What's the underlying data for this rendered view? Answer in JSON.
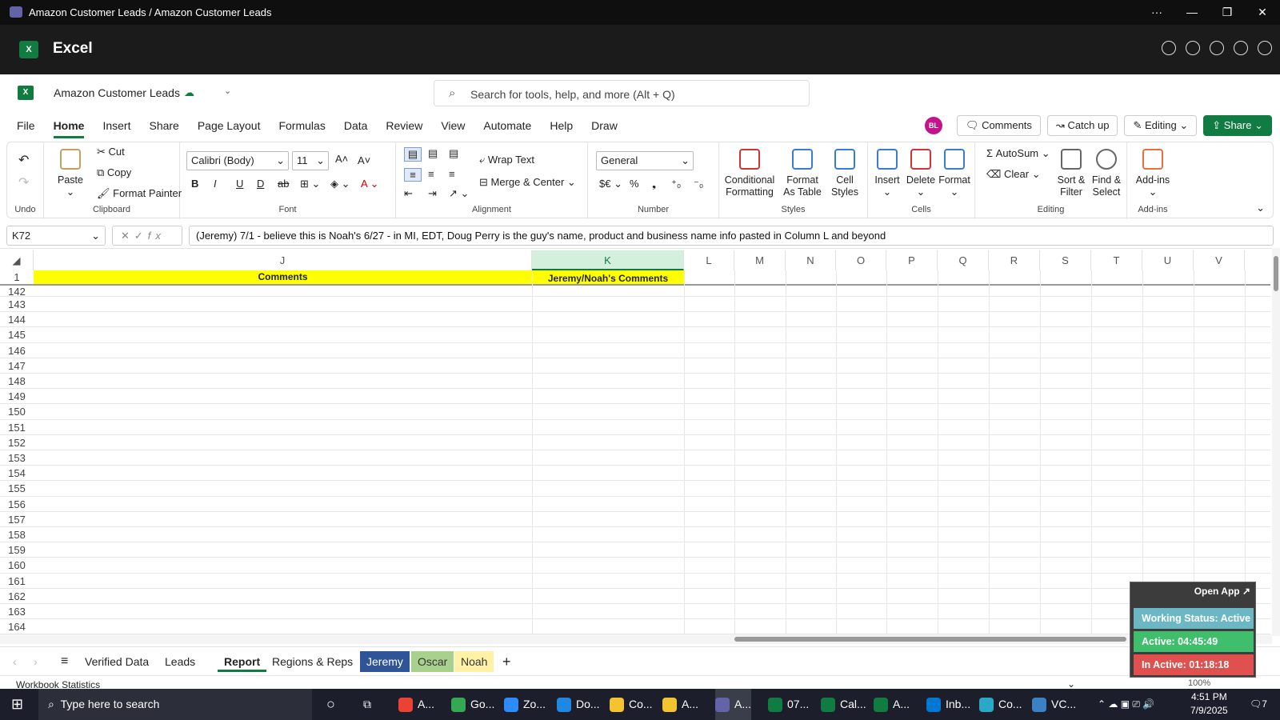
{
  "window": {
    "title": "Amazon Customer Leads / Amazon Customer Leads",
    "more": "···",
    "minimize": "—",
    "restore": "❐",
    "close": "✕"
  },
  "app": {
    "name": "Excel",
    "logo": "X"
  },
  "document": {
    "name": "Amazon Customer Leads",
    "logo": "X"
  },
  "search": {
    "placeholder": "Search for tools, help, and more (Alt + Q)"
  },
  "menu_tabs": [
    "File",
    "Home",
    "Insert",
    "Share",
    "Page Layout",
    "Formulas",
    "Data",
    "Review",
    "View",
    "Automate",
    "Help",
    "Draw"
  ],
  "active_tab": "Home",
  "header_buttons": {
    "avatar": "BL",
    "comments": "Comments",
    "catchup": "Catch up",
    "editing": "Editing",
    "share": "Share"
  },
  "ribbon": {
    "undo_label": "Undo",
    "clipboard": {
      "paste": "Paste",
      "cut": "Cut",
      "copy": "Copy",
      "format_painter": "Format Painter",
      "label": "Clipboard"
    },
    "font": {
      "family": "Calibri (Body)",
      "size": "11",
      "label": "Font"
    },
    "alignment": {
      "wrap": "Wrap Text",
      "merge": "Merge & Center",
      "label": "Alignment"
    },
    "number": {
      "format": "General",
      "label": "Number"
    },
    "styles": {
      "conditional": "Conditional Formatting",
      "format_table": "Format As Table",
      "cell_styles": "Cell Styles",
      "label": "Styles"
    },
    "cells": {
      "insert": "Insert",
      "delete": "Delete",
      "format": "Format",
      "label": "Cells"
    },
    "editing": {
      "autosum": "AutoSum",
      "clear": "Clear",
      "sort": "Sort & Filter",
      "find": "Find & Select",
      "label": "Editing"
    },
    "addins": {
      "addins": "Add-ins",
      "label": "Add-ins"
    }
  },
  "formula_bar": {
    "name_box": "K72",
    "fx": "fx",
    "formula": "(Jeremy) 7/1 -  believe this is Noah's 6/27 - in MI, EDT, Doug Perry is the guy's name, product and business name info pasted in Column L and beyond"
  },
  "grid": {
    "columns": [
      "J",
      "K",
      "L",
      "M",
      "N",
      "O",
      "P",
      "Q",
      "R",
      "S",
      "T",
      "U",
      "V"
    ],
    "selected_column": "K",
    "frozen_row": {
      "number": "1",
      "J": "Comments",
      "K": "Jeremy/Noah's Comments"
    },
    "rows": [
      "142",
      "143",
      "144",
      "145",
      "146",
      "147",
      "148",
      "149",
      "150",
      "151",
      "152",
      "153",
      "154",
      "155",
      "156",
      "157",
      "158",
      "159",
      "160",
      "161",
      "162",
      "163",
      "164"
    ]
  },
  "sheet_tabs": [
    "Verified Data",
    "Leads",
    "Report",
    "Regions & Reps",
    "Jeremy",
    "Oscar",
    "Noah"
  ],
  "active_sheet": "Report",
  "status": {
    "left": "Workbook Statistics",
    "zoom": "100%"
  },
  "widget": {
    "open_app": "Open App ↗",
    "working": "Working Status: Active",
    "active": "Active: 04:45:49",
    "inactive": "In Active: 01:18:18"
  },
  "taskbar": {
    "search": "Type here to search",
    "apps": [
      "A...",
      "Go...",
      "Zo...",
      "Do...",
      "Co...",
      "A...",
      "A...",
      "07...",
      "Cal...",
      "A...",
      "Inb...",
      "Co...",
      "VC..."
    ],
    "time": "4:51 PM",
    "date": "7/9/2025",
    "notif": "7"
  }
}
